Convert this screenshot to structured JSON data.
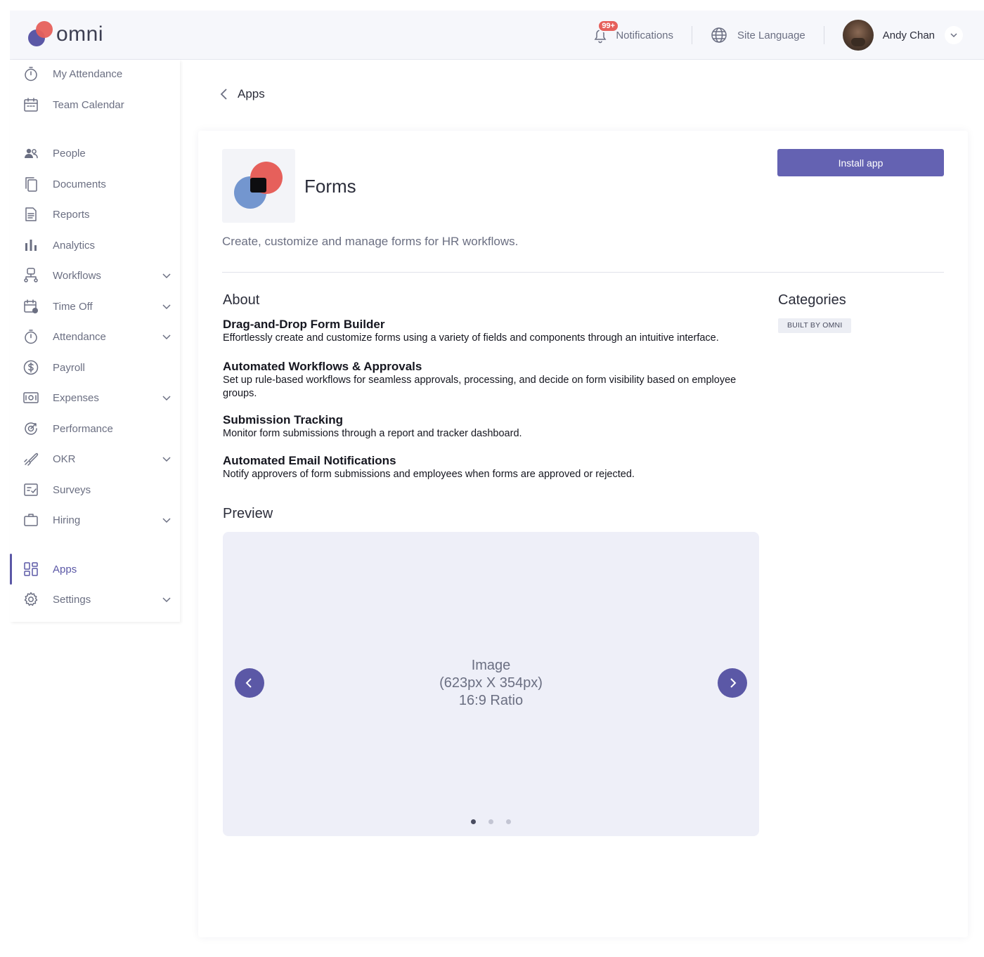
{
  "header": {
    "logo_text": "omni",
    "notifications_badge": "99+",
    "notifications_label": "Notifications",
    "site_language_label": "Site Language",
    "user_name": "Andy Chan"
  },
  "sidebar": {
    "items": [
      {
        "label": "My Attendance",
        "icon": "stopwatch-icon",
        "has_chevron": false
      },
      {
        "label": "Team Calendar",
        "icon": "calendar-icon",
        "has_chevron": false
      },
      {
        "label": "People",
        "icon": "people-icon",
        "has_chevron": false
      },
      {
        "label": "Documents",
        "icon": "documents-icon",
        "has_chevron": false
      },
      {
        "label": "Reports",
        "icon": "report-icon",
        "has_chevron": false
      },
      {
        "label": "Analytics",
        "icon": "bar-chart-icon",
        "has_chevron": false
      },
      {
        "label": "Workflows",
        "icon": "workflow-icon",
        "has_chevron": true
      },
      {
        "label": "Time Off",
        "icon": "calendar-clock-icon",
        "has_chevron": true
      },
      {
        "label": "Attendance",
        "icon": "stopwatch-icon",
        "has_chevron": true
      },
      {
        "label": "Payroll",
        "icon": "dollar-icon",
        "has_chevron": false
      },
      {
        "label": "Expenses",
        "icon": "cash-icon",
        "has_chevron": true
      },
      {
        "label": "Performance",
        "icon": "performance-icon",
        "has_chevron": false
      },
      {
        "label": "OKR",
        "icon": "rocket-icon",
        "has_chevron": true
      },
      {
        "label": "Surveys",
        "icon": "survey-icon",
        "has_chevron": false
      },
      {
        "label": "Hiring",
        "icon": "briefcase-icon",
        "has_chevron": true
      },
      {
        "label": "Apps",
        "icon": "apps-grid-icon",
        "has_chevron": false,
        "active": true
      },
      {
        "label": "Settings",
        "icon": "gear-icon",
        "has_chevron": true
      }
    ]
  },
  "breadcrumb": {
    "back_label": "Apps"
  },
  "app": {
    "title": "Forms",
    "install_label": "Install app",
    "description": "Create, customize and manage forms for HR workflows."
  },
  "about": {
    "heading": "About",
    "features": [
      {
        "title": "Drag-and-Drop Form Builder",
        "desc": "Effortlessly create and customize forms using a variety of fields and components through an intuitive interface."
      },
      {
        "title": "Automated Workflows & Approvals",
        "desc": "Set up rule-based workflows for seamless approvals, processing, and decide on form visibility based on employee groups."
      },
      {
        "title": "Submission Tracking",
        "desc": "Monitor form submissions through a report and tracker dashboard."
      },
      {
        "title": "Automated Email Notifications",
        "desc": "Notify approvers of form submissions and employees when forms are approved or rejected."
      }
    ]
  },
  "categories": {
    "heading": "Categories",
    "tags": [
      "BUILT BY OMNI"
    ]
  },
  "preview": {
    "heading": "Preview",
    "placeholder_line1": "Image",
    "placeholder_line2": "(623px X 354px)",
    "placeholder_line3": "16:9 Ratio",
    "slide_count": 3,
    "active_slide": 1
  },
  "colors": {
    "accent": "#5b58a6",
    "button": "#6462b2",
    "logo_red": "#e6605b",
    "logo_blue": "#5b58a6"
  }
}
